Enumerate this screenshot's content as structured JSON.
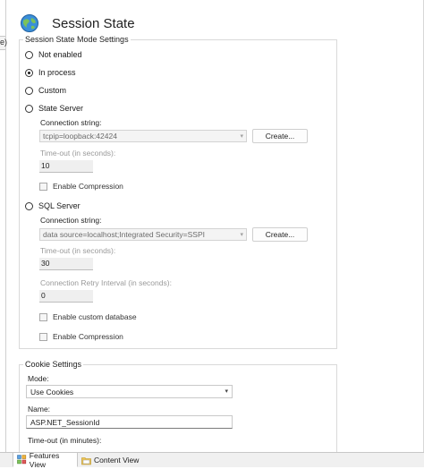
{
  "page": {
    "title": "Session State"
  },
  "left_panel": {
    "paren_text": "e)"
  },
  "mode_settings": {
    "legend": "Session State Mode Settings",
    "options": [
      {
        "label": "Not enabled",
        "selected": false
      },
      {
        "label": "In process",
        "selected": true
      },
      {
        "label": "Custom",
        "selected": false
      },
      {
        "label": "State Server",
        "selected": false
      },
      {
        "label": "SQL Server",
        "selected": false
      }
    ],
    "state_server": {
      "conn_label": "Connection string:",
      "conn_value": "tcpip=loopback:42424",
      "create_label": "Create...",
      "timeout_label": "Time-out (in seconds):",
      "timeout_value": "10",
      "compression_label": "Enable Compression"
    },
    "sql_server": {
      "conn_label": "Connection string:",
      "conn_value": "data source=localhost;Integrated Security=SSPI",
      "create_label": "Create...",
      "timeout_label": "Time-out (in seconds):",
      "timeout_value": "30",
      "retry_label": "Connection Retry Interval (in seconds):",
      "retry_value": "0",
      "custom_db_label": "Enable custom database",
      "compression_label": "Enable Compression"
    }
  },
  "cookie_settings": {
    "legend": "Cookie Settings",
    "mode_label": "Mode:",
    "mode_value": "Use Cookies",
    "name_label": "Name:",
    "name_value": "ASP.NET_SessionId",
    "timeout_label": "Time-out (in minutes):"
  },
  "tabs": [
    {
      "label": "Features View",
      "active": true
    },
    {
      "label": "Content View",
      "active": false
    }
  ],
  "icons": {
    "header": "globe-icon",
    "features_tab": "features-view-icon",
    "content_tab": "content-view-icon",
    "dropdown": "chevron-down-icon"
  },
  "colors": {
    "accent": "#1e78c8",
    "border": "#d9d9d9",
    "disabled_text": "#9a9a9a"
  }
}
